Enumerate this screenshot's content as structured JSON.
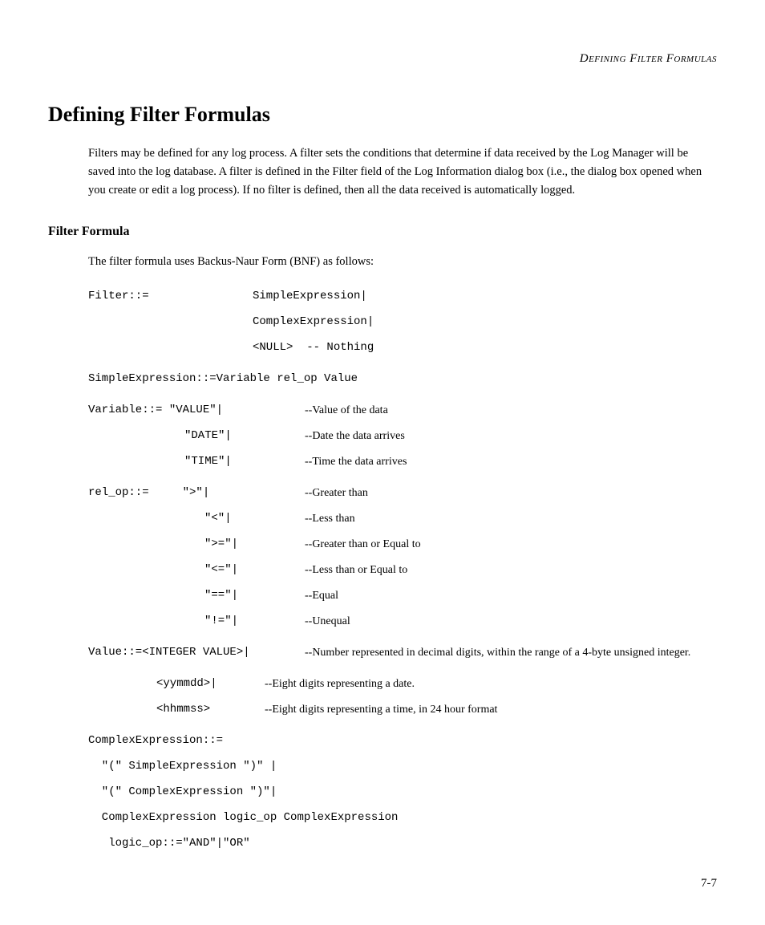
{
  "running_header": "Defining Filter Formulas",
  "h1": "Defining Filter Formulas",
  "intro": "Filters may be defined for any log process. A filter sets the conditions that determine if data received by the Log Manager will be saved into the log database. A filter is defined in the Filter field of the Log Information dialog box (i.e., the dialog box opened when you create or edit a log process). If no filter is defined, then all the data received is automatically logged.",
  "h2": "Filter Formula",
  "sub_intro": "The filter formula uses Backus-Naur Form (BNF) as follows:",
  "bnf": {
    "filter_lhs": "Filter::=",
    "filter_opts": [
      "SimpleExpression|",
      "ComplexExpression|",
      "<NULL>  -- Nothing"
    ],
    "simple_expr": "SimpleExpression::=Variable rel_op Value",
    "variable_lhs": "Variable::= \"VALUE\"|",
    "variable_desc0": "--Value of the data",
    "variable_opts": [
      {
        "code": "\"DATE\"|",
        "desc": "--Date the data arrives"
      },
      {
        "code": "\"TIME\"|",
        "desc": "--Time the data arrives"
      }
    ],
    "relop_lhs": "rel_op::=     \">\"|",
    "relop_desc0": "--Greater than",
    "relop_opts": [
      {
        "code": "\"<\"|",
        "desc": "--Less than"
      },
      {
        "code": "\">=\"|",
        "desc": "--Greater than or Equal to"
      },
      {
        "code": "\"<=\"|",
        "desc": "--Less than or Equal to"
      },
      {
        "code": "\"==\"|",
        "desc": "--Equal"
      },
      {
        "code": "\"!=\"|",
        "desc": "--Unequal"
      }
    ],
    "value_lhs": "Value::=<INTEGER VALUE>|",
    "value_desc0": "--Number represented in decimal digits, within the range of a 4-byte unsigned integer.",
    "value_opts": [
      {
        "code": "<yymmdd>|",
        "desc": "--Eight digits representing a date."
      },
      {
        "code": "<hhmmss>",
        "desc": "--Eight digits representing a time, in 24 hour format"
      }
    ],
    "complex_lhs": "ComplexExpression::=",
    "complex_lines": [
      "  \"(\" SimpleExpression \")\" |",
      "  \"(\" ComplexExpression \")\"|",
      "  ComplexExpression logic_op ComplexExpression",
      "   logic_op::=\"AND\"|\"OR\""
    ]
  },
  "page_num": "7-7"
}
